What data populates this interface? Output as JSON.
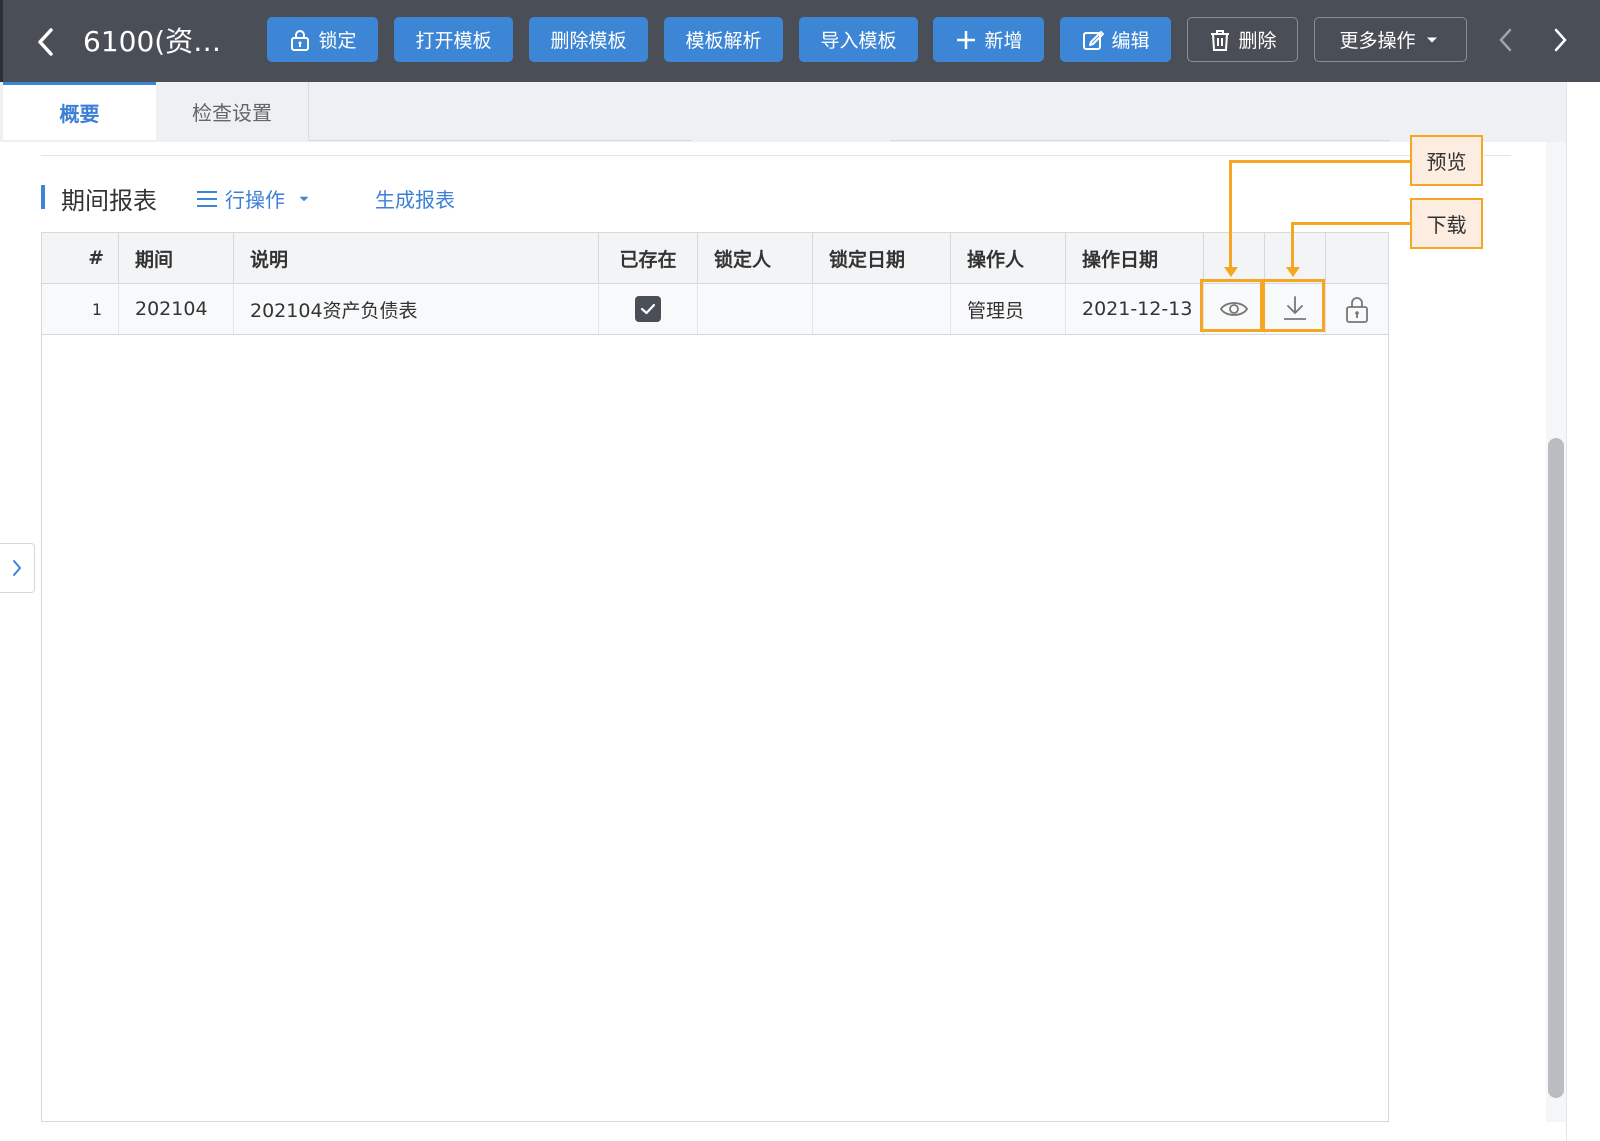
{
  "header": {
    "title": "6100(资…",
    "buttons": {
      "lock": "锁定",
      "open_template": "打开模板",
      "delete_template": "删除模板",
      "parse_template": "模板解析",
      "import_template": "导入模板",
      "add": "新增",
      "edit": "编辑",
      "delete": "删除",
      "more": "更多操作"
    }
  },
  "tabs": [
    "概要",
    "检查设置"
  ],
  "section": {
    "title": "期间报表",
    "row_ops": "行操作",
    "generate_report": "生成报表"
  },
  "table": {
    "columns": [
      "#",
      "期间",
      "说明",
      "已存在",
      "锁定人",
      "锁定日期",
      "操作人",
      "操作日期"
    ],
    "rows": [
      {
        "index": "1",
        "period": "202104",
        "desc": "202104资产负债表",
        "exists": true,
        "locker": "",
        "lock_date": "",
        "operator": "管理员",
        "op_date": "2021-12-13"
      }
    ]
  },
  "callouts": {
    "preview": "预览",
    "download": "下载"
  },
  "colors": {
    "toolbar_bg": "#4a4f57",
    "primary": "#3d86d6",
    "highlight": "#f5a623",
    "callout_bg": "#fdece0"
  },
  "icons": {
    "back": "chevron-left-icon",
    "lock": "lock-icon",
    "plus": "plus-icon",
    "edit": "edit-icon",
    "trash": "trash-icon",
    "caret": "caret-down-icon",
    "menu": "menu-icon",
    "check": "check-icon",
    "eye": "eye-icon",
    "download": "download-icon"
  }
}
